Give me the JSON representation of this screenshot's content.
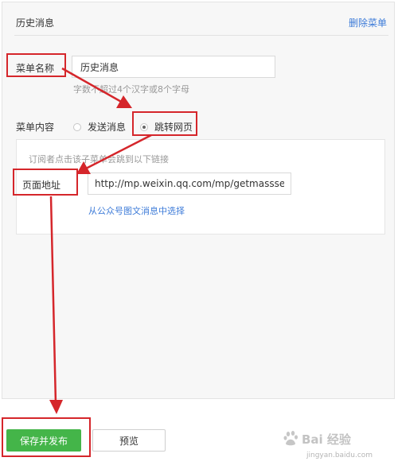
{
  "header": {
    "title": "历史消息",
    "delete_label": "删除菜单"
  },
  "menu_name": {
    "label": "菜单名称",
    "value": "历史消息",
    "hint": "字数不超过4个汉字或8个字母"
  },
  "menu_content": {
    "label": "菜单内容",
    "options": [
      {
        "label": "发送消息",
        "selected": false
      },
      {
        "label": "跳转网页",
        "selected": true
      }
    ]
  },
  "link_panel": {
    "hint": "订阅者点击该子菜单会跳到以下链接",
    "address_label": "页面地址",
    "url_value": "http://mp.weixin.qq.com/mp/getmasssend",
    "select_link": "从公众号图文消息中选择"
  },
  "actions": {
    "save_publish": "保存并发布",
    "preview": "预览"
  },
  "watermark": {
    "brand": "Bai 经验",
    "domain": "jingyan.baidu.com"
  },
  "colors": {
    "annotation_red": "#d5262b",
    "primary_green": "#44b549",
    "link_blue": "#3d7bd8"
  }
}
